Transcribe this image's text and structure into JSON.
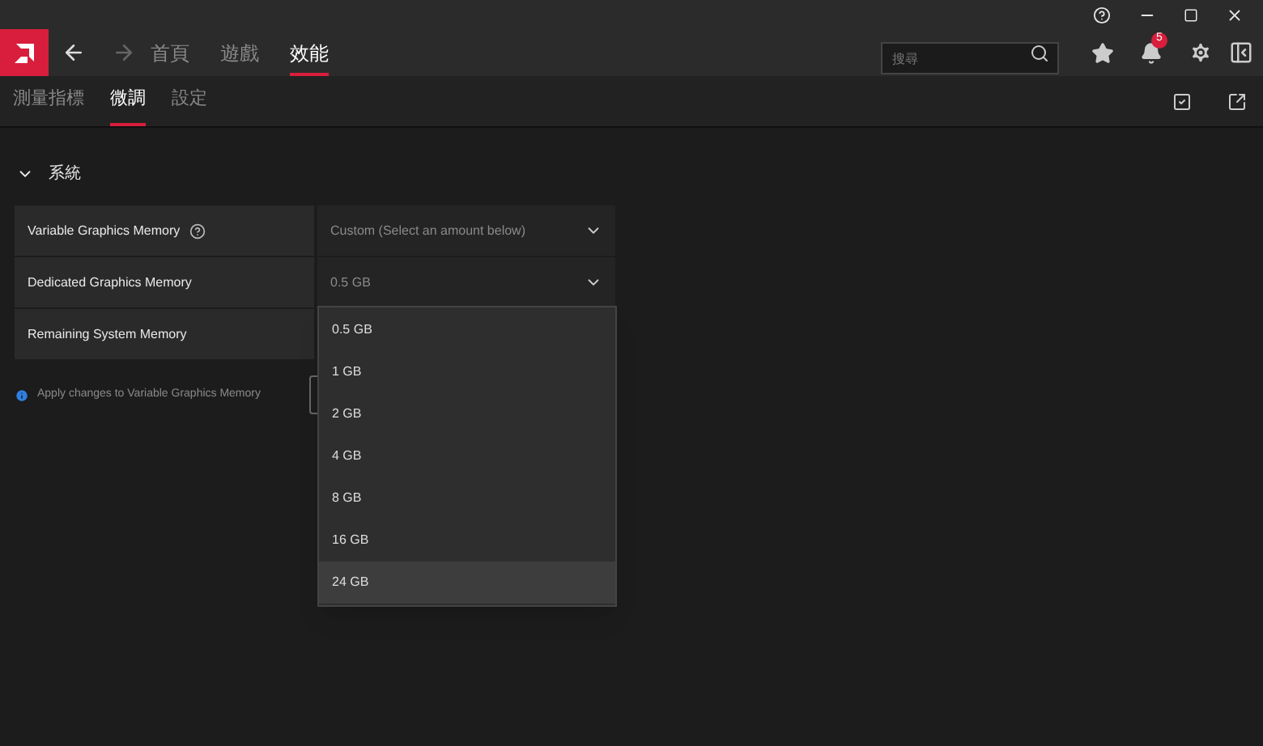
{
  "nav": {
    "tabs": [
      {
        "label": "首頁",
        "selected": false
      },
      {
        "label": "遊戲",
        "selected": false
      },
      {
        "label": "效能",
        "selected": true
      }
    ],
    "back_disabled": false,
    "forward_disabled": true
  },
  "search": {
    "placeholder": "搜尋"
  },
  "notifications": {
    "count": "5"
  },
  "subtabs": [
    {
      "label": "測量指標",
      "selected": false
    },
    {
      "label": "微調",
      "selected": true
    },
    {
      "label": "設定",
      "selected": false
    }
  ],
  "section": {
    "title": "系統",
    "expanded": true
  },
  "rows": [
    {
      "label": "Variable Graphics Memory",
      "help": true,
      "value": "Custom (Select an amount below)"
    },
    {
      "label": "Dedicated Graphics Memory",
      "help": false,
      "value": "0.5 GB"
    },
    {
      "label": "Remaining System Memory",
      "help": false
    }
  ],
  "info": "Apply changes to Variable Graphics Memory",
  "dropdown": {
    "options": [
      {
        "label": "0.5 GB",
        "selected": false
      },
      {
        "label": "1 GB",
        "selected": false
      },
      {
        "label": "2 GB",
        "selected": false
      },
      {
        "label": "4 GB",
        "selected": false
      },
      {
        "label": "8 GB",
        "selected": false
      },
      {
        "label": "16 GB",
        "selected": false
      },
      {
        "label": "24 GB",
        "selected": true
      }
    ]
  }
}
